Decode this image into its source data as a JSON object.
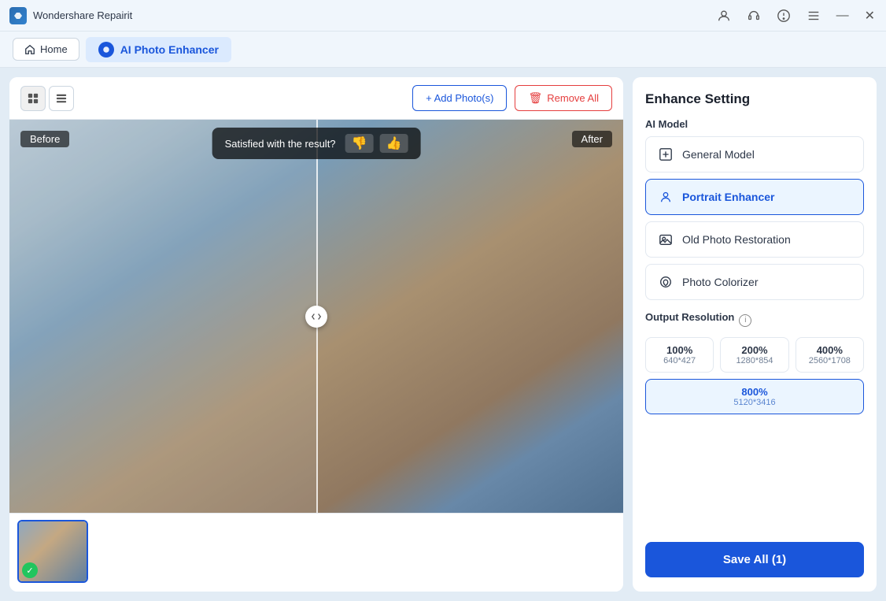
{
  "titleBar": {
    "appName": "Wondershare Repairit"
  },
  "navBar": {
    "homeLabel": "Home",
    "tabLabel": "AI Photo Enhancer"
  },
  "toolbar": {
    "addPhotosLabel": "+ Add Photo(s)",
    "removeAllLabel": "Remove All"
  },
  "imageArea": {
    "beforeLabel": "Before",
    "afterLabel": "After",
    "satisfactionText": "Satisfied with the result?",
    "thumbUpLabel": "👍",
    "thumbDownLabel": "👎"
  },
  "rightPanel": {
    "title": "Enhance Setting",
    "aiModelLabel": "AI Model",
    "models": [
      {
        "id": "general",
        "label": "General Model",
        "active": false
      },
      {
        "id": "portrait",
        "label": "Portrait Enhancer",
        "active": true
      },
      {
        "id": "old-photo",
        "label": "Old Photo Restoration",
        "active": false
      },
      {
        "id": "colorizer",
        "label": "Photo Colorizer",
        "active": false
      }
    ],
    "outputResLabel": "Output Resolution",
    "resolutions": [
      {
        "pct": "100%",
        "dim": "640*427",
        "active": false
      },
      {
        "pct": "200%",
        "dim": "1280*854",
        "active": false
      },
      {
        "pct": "400%",
        "dim": "2560*1708",
        "active": false
      }
    ],
    "activeRes": {
      "pct": "800%",
      "dim": "5120*3416"
    },
    "saveLabel": "Save All (1)"
  }
}
